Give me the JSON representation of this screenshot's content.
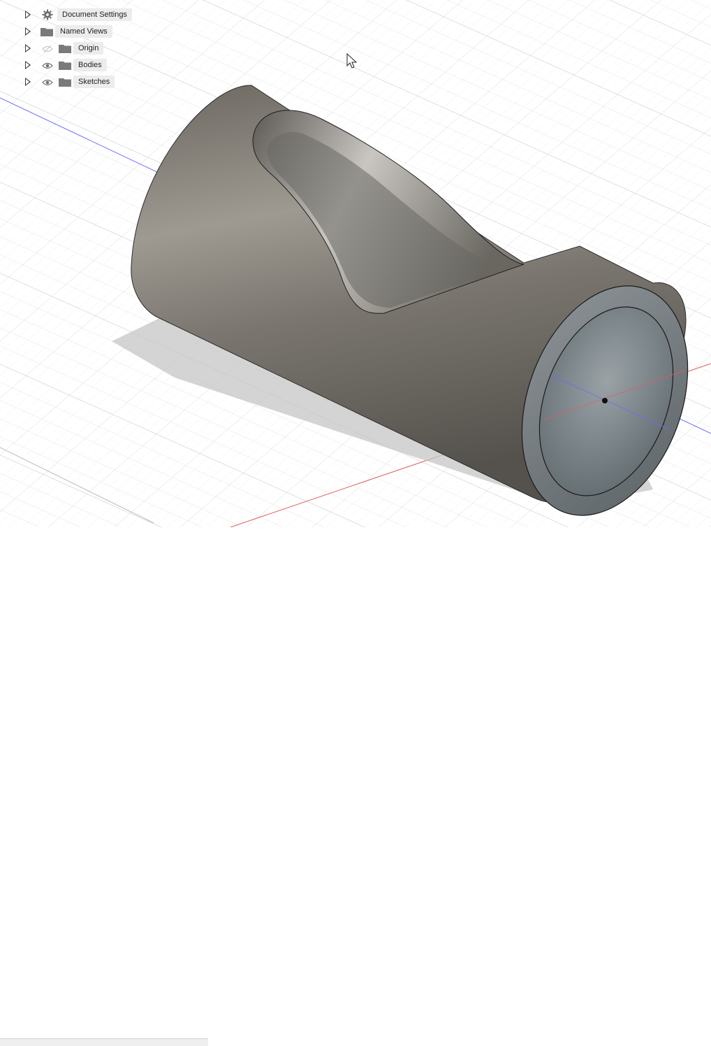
{
  "browser": {
    "items": [
      {
        "label": "Document Settings",
        "icon": "gear-icon",
        "has_eye": false
      },
      {
        "label": "Named Views",
        "icon": "folder-icon",
        "has_eye": false
      },
      {
        "label": "Origin",
        "icon": "folder-icon",
        "has_eye": true,
        "visible": false
      },
      {
        "label": "Bodies",
        "icon": "folder-icon",
        "has_eye": true,
        "visible": true
      },
      {
        "label": "Sketches",
        "icon": "folder-icon",
        "has_eye": true,
        "visible": true
      }
    ]
  },
  "colors": {
    "grid_minor": "#e7e7e7",
    "grid_major": "#cfcfcf",
    "axis_x": "#e25d5d",
    "axis_y": "#6b6bff",
    "body_light": "#9a968e",
    "body_dark": "#5f5c56",
    "shadow": "#bdbdbd"
  }
}
